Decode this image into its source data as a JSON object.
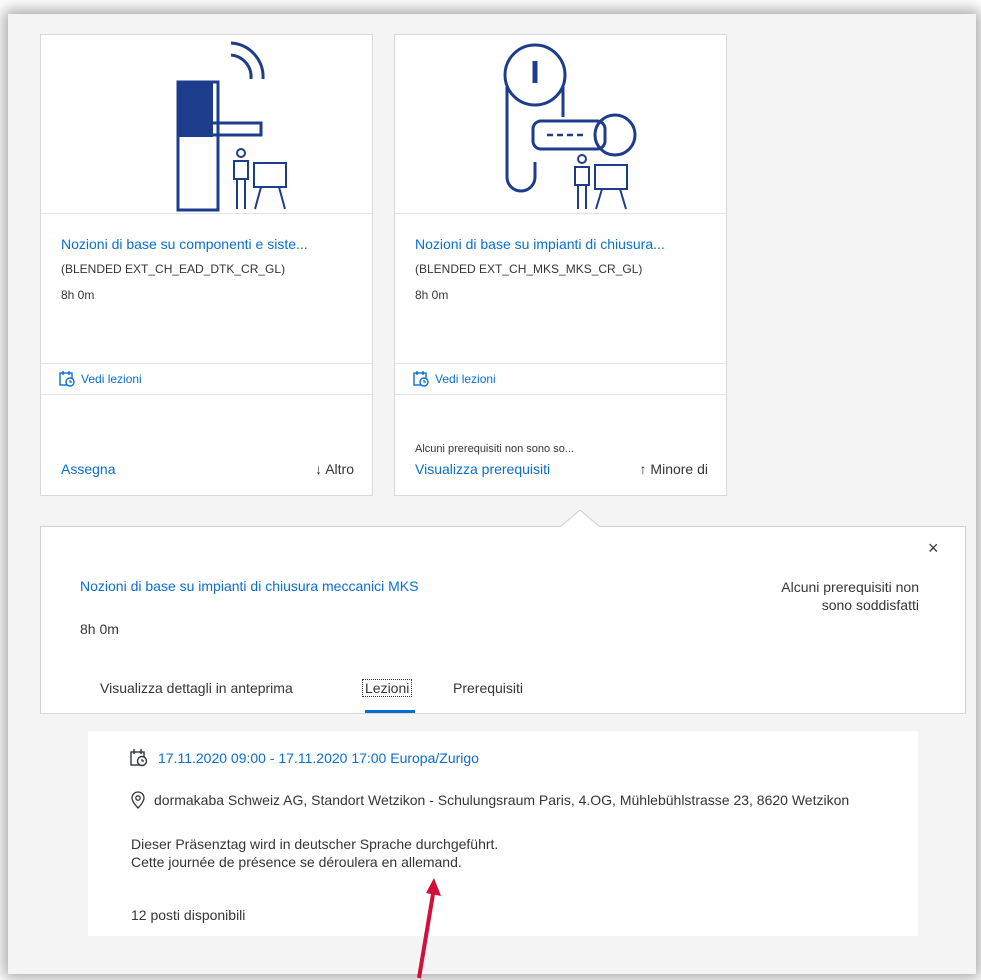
{
  "cards": [
    {
      "title": "Nozioni di base su componenti e siste...",
      "code": "(BLENDED EXT_CH_EAD_DTK_CR_GL)",
      "duration": "8h 0m",
      "lessons_link": "Vedi lezioni",
      "warning": "",
      "action": "Assegna",
      "toggle": "↓ Altro",
      "icon": "door-handle-wireless-icon"
    },
    {
      "title": "Nozioni di base su impianti di chiusura...",
      "code": "(BLENDED EXT_CH_MKS_MKS_CR_GL)",
      "duration": "8h 0m",
      "lessons_link": "Vedi lezioni",
      "warning": "Alcuni prerequisiti non sono so...",
      "action": "Visualizza prerequisiti",
      "toggle": "↑ Minore di",
      "icon": "key-cylinder-icon"
    }
  ],
  "popover": {
    "close": "×",
    "title": "Nozioni di base su impianti di chiusura meccanici MKS",
    "status_line1": "Alcuni prerequisiti non",
    "status_line2": "sono soddisfatti",
    "duration": "8h 0m",
    "tabs": [
      "Visualizza dettagli in anteprima",
      "Lezioni",
      "Prerequisiti"
    ],
    "active_tab": "Lezioni",
    "lesson": {
      "date": "17.11.2020 09:00 - 17.11.2020 17:00 Europa/Zurigo",
      "location": "dormakaba Schweiz AG, Standort Wetzikon - Schulungsraum Paris, 4.OG, Mühlebühlstrasse 23, 8620 Wetzikon",
      "desc_line1": "Dieser Präsenztag wird in deutscher Sprache durchgeführt.",
      "desc_line2": "Cette journée de présence se déroulera en allemand.",
      "seats": "12 posti disponibili"
    }
  },
  "colors": {
    "link": "#0a6ed1",
    "icon_navy": "#1e3c8c",
    "text": "#32363a",
    "annotation_arrow": "#d0103a"
  }
}
